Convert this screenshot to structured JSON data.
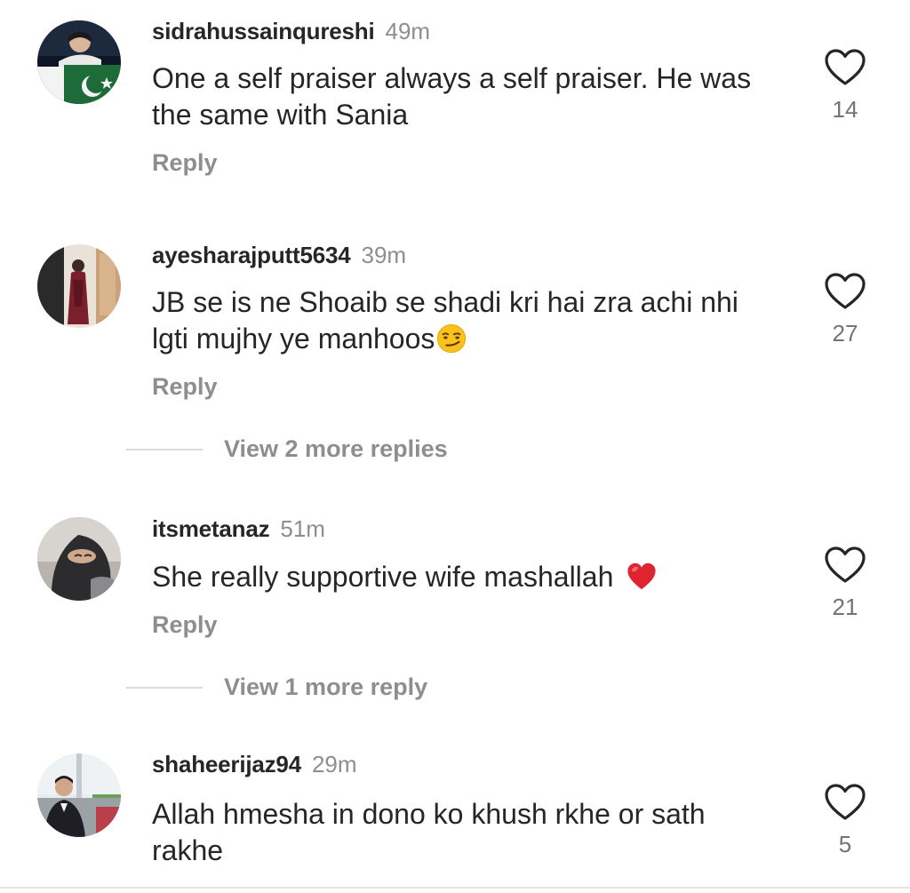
{
  "comments": [
    {
      "username": "sidrahussainqureshi",
      "time": "49m",
      "text": "One a self praiser always a self praiser. He was the same with Sania",
      "reply_label": "Reply",
      "likes": "14",
      "avatar_icon": "flag-portrait-avatar"
    },
    {
      "username": "ayesharajputt5634",
      "time": "39m",
      "text": "JB se is ne Shoaib se shadi kri hai zra achi nhi lgti mujhy ye manhoos",
      "emoji": "smirking-face-emoji",
      "reply_label": "Reply",
      "likes": "27",
      "view_more": "View 2 more replies",
      "avatar_icon": "standing-woman-avatar"
    },
    {
      "username": "itsmetanaz",
      "time": "51m",
      "text": "She really supportive wife mashallah",
      "emoji": "red-heart-emoji",
      "reply_label": "Reply",
      "likes": "21",
      "view_more": "View 1 more reply",
      "avatar_icon": "veiled-face-avatar"
    },
    {
      "username": "shaheerijaz94",
      "time": "29m",
      "text": "Allah hmesha in dono ko khush rkhe or sath rakhe",
      "likes": "5",
      "avatar_icon": "outdoor-portrait-avatar"
    }
  ],
  "colors": {
    "username": "#262626",
    "secondary_text": "#8e8e8e",
    "divider": "#dbdbdb",
    "heart_emoji": "#e0242f"
  }
}
